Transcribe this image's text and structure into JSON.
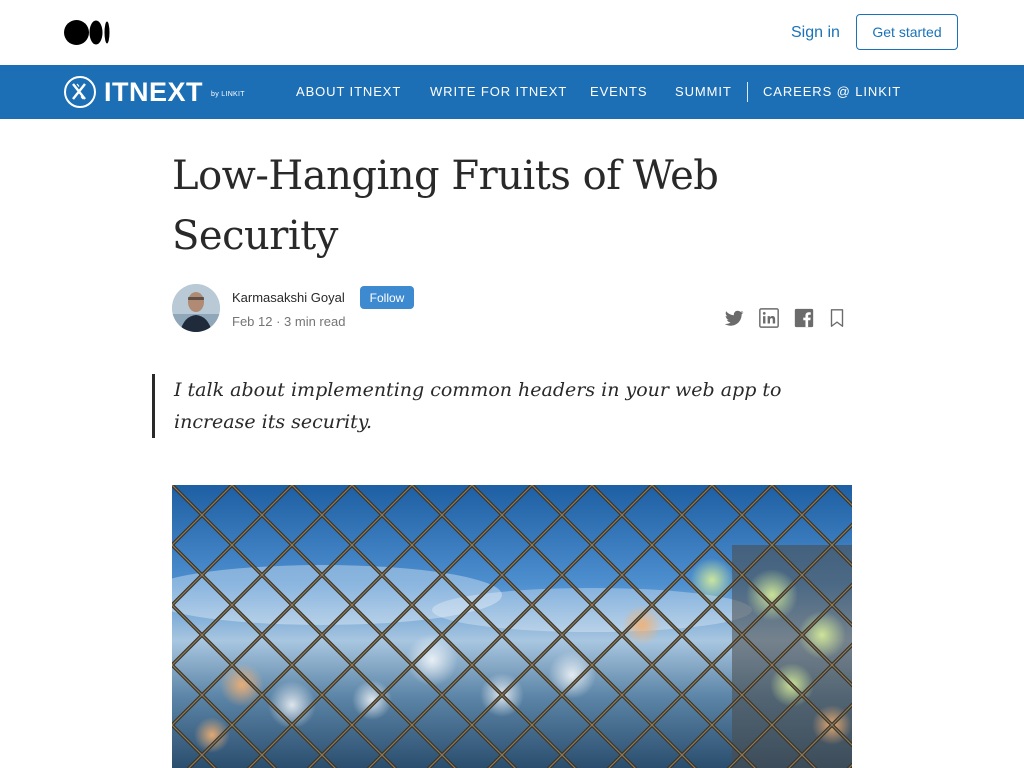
{
  "header": {
    "sign_in": "Sign in",
    "get_started": "Get started"
  },
  "publication": {
    "name": "ITNEXT",
    "by": "by LINKIT",
    "nav": [
      "ABOUT ITNEXT",
      "WRITE FOR ITNEXT",
      "EVENTS",
      "SUMMIT",
      "CAREERS @ LINKIT"
    ],
    "color": "#1d6fb5"
  },
  "article": {
    "title": "Low-Hanging Fruits of Web Security",
    "author": "Karmasakshi Goyal",
    "follow": "Follow",
    "meta": "Feb 12 · 3 min read",
    "subtitle": "I talk about implementing common headers in your web app to increase its security.",
    "share_icons": [
      "twitter-icon",
      "linkedin-icon",
      "facebook-icon",
      "bookmark-icon"
    ]
  },
  "colors": {
    "accent": "#1a73b8",
    "follow_bg": "#3d8ad0"
  }
}
